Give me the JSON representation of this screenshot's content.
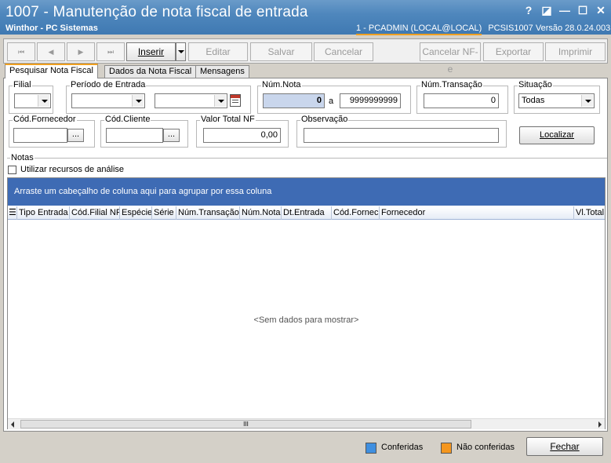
{
  "window": {
    "title": "1007 - Manutenção de nota fiscal de entrada",
    "subtitle": "Winthor - PC Sistemas",
    "session_user": "1 - PCADMIN (LOCAL@LOCAL)",
    "session_info": "PCSIS1007  Versão  28.0.24.003",
    "controls": {
      "help": "?",
      "restore": "◪",
      "minimize": "—",
      "maximize": "☐",
      "close": "✕"
    }
  },
  "toolbar": {
    "first": "⏮",
    "prev": "◀",
    "next": "▶",
    "last": "⏭",
    "inserir": "Inserir",
    "editar": "Editar",
    "salvar": "Salvar",
    "cancelar": "Cancelar",
    "cancelar_nfe": "Cancelar NF-e",
    "exportar": "Exportar",
    "imprimir": "Imprimir"
  },
  "tabs": [
    "Pesquisar Nota Fiscal",
    "Dados da Nota Fiscal",
    "Mensagens"
  ],
  "filters": {
    "filial_label": "Filial",
    "periodo_label": "Período de Entrada",
    "num_nota_label": "Núm.Nota",
    "num_nota_from": "0",
    "num_nota_sep": "a",
    "num_nota_to": "9999999999",
    "num_transacao_label": "Núm.Transação",
    "num_transacao_value": "0",
    "situacao_label": "Situação",
    "situacao_value": "Todas",
    "cod_fornecedor_label": "Cód.Fornecedor",
    "cod_cliente_label": "Cód.Cliente",
    "valor_total_label": "Valor Total NF",
    "valor_total_value": "0,00",
    "observacao_label": "Observação",
    "ellipsis": "...",
    "localizar": "Localizar"
  },
  "notas": {
    "label": "Notas",
    "analise_label": "Utilizar recursos de análise",
    "analise_checked": false
  },
  "grid": {
    "group_hint": "Arraste um cabeçalho de coluna aqui para agrupar por essa coluna",
    "columns": [
      "Tipo Entrada",
      "Cód.Filial NF",
      "Espécie",
      "Série",
      "Núm.Transação",
      "Núm.Nota",
      "Dt.Entrada",
      "Cód.Fornec",
      "Fornecedor",
      "Vl.Total"
    ],
    "empty_text": "<Sem dados para mostrar>",
    "scroll_grip": "III"
  },
  "status": {
    "conferidas_label": "Conferidas",
    "conferidas_color": "#3f8fe0",
    "nao_conferidas_label": "Não conferidas",
    "nao_conferidas_color": "#f4961e",
    "fechar": "Fechar"
  }
}
